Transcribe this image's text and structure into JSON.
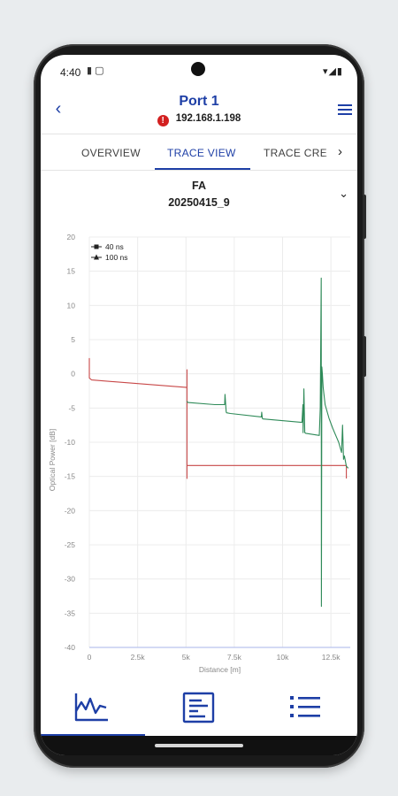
{
  "status_bar": {
    "time": "4:40",
    "icons_left": "▮ ▢",
    "icons_right": "▾◢▮"
  },
  "header": {
    "title": "Port 1",
    "alert_symbol": "!",
    "ip": "192.168.1.198",
    "back_glyph": "‹"
  },
  "tabs": [
    {
      "label": "OVERVIEW",
      "active": false
    },
    {
      "label": "TRACE VIEW",
      "active": true
    },
    {
      "label": "TRACE CRE",
      "active": false
    }
  ],
  "tab_more_glyph": "›",
  "selector": {
    "line1": "FA",
    "line2": "20250415_9",
    "caret": "⌄"
  },
  "colors": {
    "accent": "#1e3fa6",
    "trace_40ns": "#c84848",
    "trace_100ns": "#2e8a58",
    "alert": "#d32020"
  },
  "chart_data": {
    "type": "line",
    "xlabel": "Distance [m]",
    "ylabel": "Optical Power [dB]",
    "xlim": [
      0,
      13500
    ],
    "ylim": [
      -40,
      20
    ],
    "xticks": [
      0,
      2500,
      5000,
      7500,
      10000,
      12500
    ],
    "xtick_labels": [
      "0",
      "2.5k",
      "5k",
      "7.5k",
      "10k",
      "12.5k"
    ],
    "yticks": [
      20,
      15,
      10,
      5,
      0,
      -5,
      -10,
      -15,
      -20,
      -25,
      -30,
      -35,
      -40
    ],
    "grid": true,
    "legend_position": "top-left",
    "series": [
      {
        "name": "40 ns",
        "color": "#c84848",
        "x": [
          0,
          0,
          120,
          5050,
          5050,
          5050,
          5050,
          13300,
          13300,
          13300
        ],
        "y": [
          2.3,
          -0.6,
          -0.9,
          -2.0,
          0.6,
          -15.3,
          -13.4,
          -13.4,
          -13.4,
          -15.3
        ]
      },
      {
        "name": "100 ns",
        "color": "#2e8a58",
        "x": [
          5050,
          5100,
          6500,
          7000,
          7020,
          7080,
          7100,
          7300,
          8900,
          8920,
          8950,
          8980,
          9000,
          11000,
          11050,
          11060,
          11100,
          11150,
          11200,
          11900,
          11950,
          12000,
          12010,
          12030,
          12060,
          12100,
          12200,
          12400,
          12600,
          12900,
          13050,
          13100,
          13150,
          13200,
          13300,
          13400
        ],
        "y": [
          -4.0,
          -4.2,
          -4.5,
          -4.5,
          -3.0,
          -5.5,
          -5.7,
          -5.8,
          -6.3,
          -5.6,
          -6.5,
          -6.6,
          -6.6,
          -7.1,
          -4.5,
          -8.6,
          -2.2,
          -8.6,
          -8.7,
          -9.0,
          -5.0,
          14.0,
          -34.0,
          1.0,
          0.0,
          -2.0,
          -4.5,
          -6.5,
          -8.0,
          -10.0,
          -11.5,
          -7.5,
          -12.5,
          -12.0,
          -13.5,
          -13.8
        ]
      }
    ]
  },
  "bottom_nav": [
    {
      "icon": "trace-chart-icon",
      "active": true
    },
    {
      "icon": "report-document-icon",
      "active": false
    },
    {
      "icon": "list-icon",
      "active": false
    }
  ]
}
